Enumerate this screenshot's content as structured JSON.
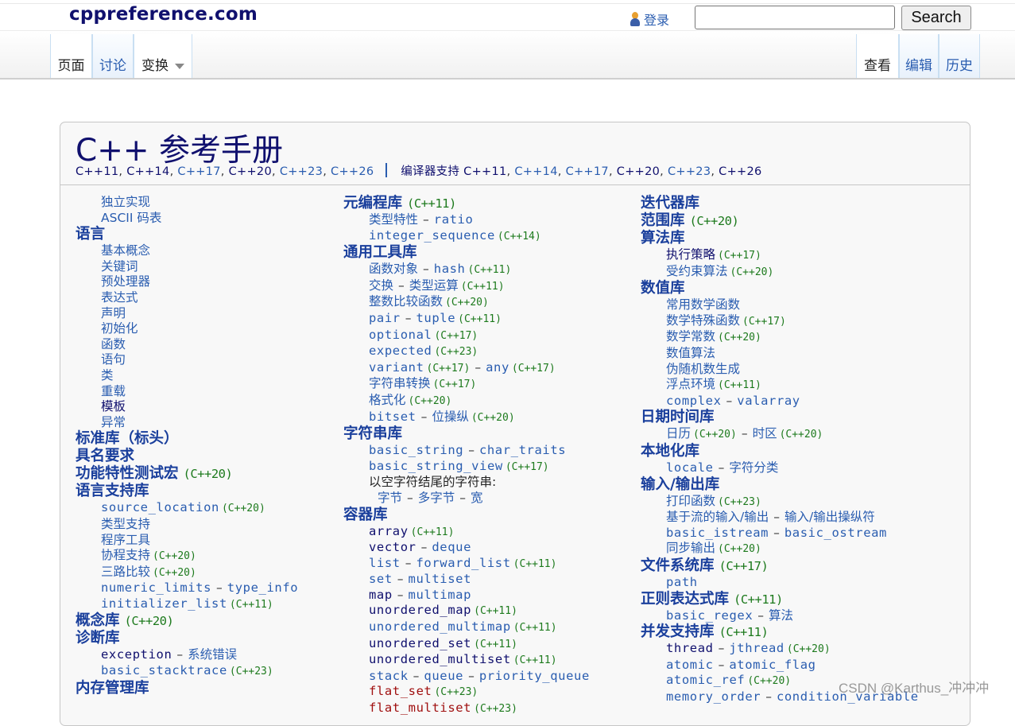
{
  "header": {
    "site_title": "cppreference.com",
    "login_label": "登录",
    "search_placeholder": "",
    "search_value": "",
    "search_button": "Search"
  },
  "nav": {
    "left_tabs": [
      {
        "label": "页面",
        "selected": true
      },
      {
        "label": "讨论",
        "selected": false
      },
      {
        "label": "变换",
        "selected": true,
        "dropdown": true
      }
    ],
    "right_tabs": [
      {
        "label": "查看",
        "selected": true
      },
      {
        "label": "编辑",
        "selected": false
      },
      {
        "label": "历史",
        "selected": false
      }
    ]
  },
  "card": {
    "title": "C++ 参考手册",
    "standards": [
      "C++11",
      "C++14",
      "C++17",
      "C++20",
      "C++23",
      "C++26"
    ],
    "compiler_support_label": "编译器支持",
    "compiler_support": [
      "C++11",
      "C++14",
      "C++17",
      "C++20",
      "C++23",
      "C++26"
    ]
  },
  "columns": {
    "col1": {
      "items_top": [
        "独立实现",
        "ASCII 码表"
      ],
      "lang": {
        "heading": "语言",
        "items": [
          "基本概念",
          "关键词",
          "预处理器",
          "表达式",
          "声明",
          "初始化",
          "函数",
          "语句",
          "类",
          "重载",
          "模板",
          "异常"
        ]
      },
      "stdlib": {
        "heading": "标准库（标头）"
      },
      "named_req": {
        "heading": "具名要求"
      },
      "feature_test": {
        "heading": "功能特性测试宏",
        "ver": "(C++20)"
      },
      "lang_support": {
        "heading": "语言支持库",
        "items": [
          {
            "a": "source_location",
            "ver": "(C++20)"
          },
          {
            "a": "类型支持"
          },
          {
            "a": "程序工具"
          },
          {
            "a": "协程支持",
            "ver": "(C++20)"
          },
          {
            "a": "三路比较",
            "ver": "(C++20)"
          },
          {
            "a": "numeric_limits",
            "b": "type_info"
          },
          {
            "a": "initializer_list",
            "ver": "(C++11)"
          }
        ]
      },
      "concepts": {
        "heading": "概念库",
        "ver": "(C++20)"
      },
      "diagnostics": {
        "heading": "诊断库",
        "items": [
          {
            "a": "exception",
            "b": "系统错误"
          },
          {
            "a": "basic_stacktrace",
            "ver": "(C++23)"
          }
        ]
      },
      "memory": {
        "heading": "内存管理库"
      }
    },
    "col2": {
      "meta": {
        "heading": "元编程库",
        "ver": "(C++11)",
        "items": [
          {
            "a": "类型特性",
            "b": "ratio"
          },
          {
            "a": "integer_sequence",
            "ver": "(C++14)"
          }
        ]
      },
      "utility": {
        "heading": "通用工具库",
        "items": [
          {
            "a": "函数对象",
            "b": "hash",
            "ver": "(C++11)"
          },
          {
            "a": "交换",
            "b": "类型运算",
            "ver": "(C++11)"
          },
          {
            "a": "整数比较函数",
            "ver": "(C++20)"
          },
          {
            "a": "pair",
            "b": "tuple",
            "ver": "(C++11)"
          },
          {
            "a": "optional",
            "ver": "(C++17)"
          },
          {
            "a": "expected",
            "ver": "(C++23)"
          },
          {
            "a": "variant",
            "ver": "(C++17)",
            "b": "any",
            "ver2": "(C++17)"
          },
          {
            "a": "字符串转换",
            "ver": "(C++17)"
          },
          {
            "a": "格式化",
            "ver": "(C++20)"
          },
          {
            "a": "bitset",
            "b": "位操纵",
            "ver": "(C++20)"
          }
        ]
      },
      "strings": {
        "heading": "字符串库",
        "items": [
          {
            "a": "basic_string",
            "b": "char_traits"
          },
          {
            "a": "basic_string_view",
            "ver": "(C++17)"
          }
        ],
        "null_terminated_label": "以空字符结尾的字符串:",
        "null_terminated": [
          "字节",
          "多字节",
          "宽"
        ]
      },
      "containers": {
        "heading": "容器库",
        "items": [
          {
            "a": "array",
            "ver": "(C++11)"
          },
          {
            "a": "vector",
            "b": "deque"
          },
          {
            "a": "list",
            "b": "forward_list",
            "ver": "(C++11)"
          },
          {
            "a": "set",
            "b": "multiset"
          },
          {
            "a": "map",
            "b": "multimap"
          },
          {
            "a": "unordered_map",
            "ver": "(C++11)"
          },
          {
            "a": "unordered_multimap",
            "ver": "(C++11)"
          },
          {
            "a": "unordered_set",
            "ver": "(C++11)"
          },
          {
            "a": "unordered_multiset",
            "ver": "(C++11)"
          },
          {
            "a": "stack",
            "b": "queue",
            "c": "priority_queue"
          },
          {
            "a": "flat_set",
            "ver": "(C++23)"
          },
          {
            "a": "flat_multiset",
            "ver": "(C++23)"
          }
        ]
      }
    },
    "col3": {
      "iterators": {
        "heading": "迭代器库"
      },
      "ranges": {
        "heading": "范围库",
        "ver": "(C++20)"
      },
      "algorithms": {
        "heading": "算法库",
        "items": [
          {
            "a": "执行策略",
            "ver": "(C++17)"
          },
          {
            "a": "受约束算法",
            "ver": "(C++20)"
          }
        ]
      },
      "numerics": {
        "heading": "数值库",
        "items": [
          {
            "a": "常用数学函数"
          },
          {
            "a": "数学特殊函数",
            "ver": "(C++17)"
          },
          {
            "a": "数学常数",
            "ver": "(C++20)"
          },
          {
            "a": "数值算法"
          },
          {
            "a": "伪随机数生成"
          },
          {
            "a": "浮点环境",
            "ver": "(C++11)"
          },
          {
            "a": "complex",
            "b": "valarray"
          }
        ]
      },
      "datetime": {
        "heading": "日期时间库",
        "items": [
          {
            "a": "日历",
            "ver": "(C++20)",
            "b": "时区",
            "ver2": "(C++20)"
          }
        ]
      },
      "localization": {
        "heading": "本地化库",
        "items": [
          {
            "a": "locale",
            "b": "字符分类"
          }
        ]
      },
      "io": {
        "heading": "输入/输出库",
        "items": [
          {
            "a": "打印函数",
            "ver": "(C++23)"
          },
          {
            "a": "基于流的输入/输出",
            "b": "输入/输出操纵符"
          },
          {
            "a": "basic_istream",
            "b": "basic_ostream"
          },
          {
            "a": "同步输出",
            "ver": "(C++20)"
          }
        ]
      },
      "filesystem": {
        "heading": "文件系统库",
        "ver": "(C++17)",
        "items": [
          {
            "a": "path"
          }
        ]
      },
      "regex": {
        "heading": "正则表达式库",
        "ver": "(C++11)",
        "items": [
          {
            "a": "basic_regex",
            "b": "算法"
          }
        ]
      },
      "concurrency": {
        "heading": "并发支持库",
        "ver": "(C++11)",
        "items": [
          {
            "a": "thread",
            "b": "jthread",
            "ver": "(C++20)"
          },
          {
            "a": "atomic",
            "b": "atomic_flag"
          },
          {
            "a": "atomic_ref",
            "ver": "(C++20)"
          },
          {
            "a": "memory_order",
            "b": "condition_variable"
          }
        ]
      }
    }
  },
  "watermark": "CSDN @Karthus_冲冲冲",
  "colors": {
    "title": "#10106e",
    "link": "#2a5db0",
    "heading": "#1a3f9c",
    "version": "#1d7a1d",
    "newlink": "#a01010"
  }
}
